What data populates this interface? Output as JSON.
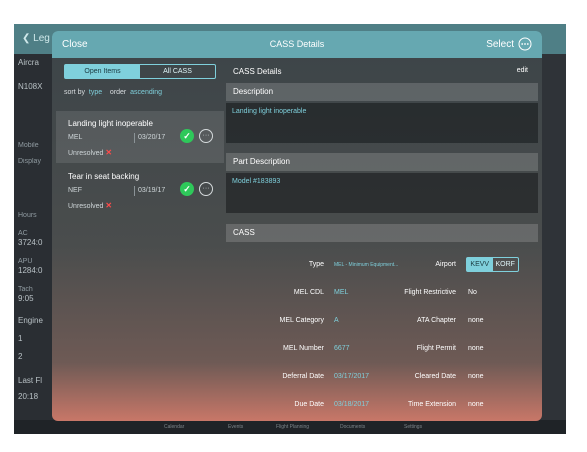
{
  "background": {
    "back_label": "Leg",
    "sidebar": [
      {
        "text": "Aircra",
        "kind": "val"
      },
      {
        "text": "N108X",
        "kind": "val"
      },
      {
        "text": "Mobile",
        "kind": "lbl"
      },
      {
        "text": "Display",
        "kind": "lbl"
      },
      {
        "text": "Hours",
        "kind": "lbl"
      },
      {
        "text": "AC",
        "kind": "lbl"
      },
      {
        "text": "3724:0",
        "kind": "val"
      },
      {
        "text": "APU",
        "kind": "lbl"
      },
      {
        "text": "1284:0",
        "kind": "val"
      },
      {
        "text": "Tach",
        "kind": "lbl"
      },
      {
        "text": "9:05",
        "kind": "val"
      },
      {
        "text": "Engine",
        "kind": "val"
      },
      {
        "text": "1",
        "kind": "val"
      },
      {
        "text": "2",
        "kind": "val"
      },
      {
        "text": "Last Fl",
        "kind": "val"
      },
      {
        "text": "20:18",
        "kind": "val"
      }
    ],
    "tabbar": [
      "Calendar",
      "Events",
      "Flight Planning",
      "Documents",
      "Settings"
    ]
  },
  "modal": {
    "close_label": "Close",
    "title": "CASS Details",
    "select_label": "Select"
  },
  "left": {
    "segments": [
      {
        "label": "Open Items",
        "active": true
      },
      {
        "label": "All CASS",
        "active": false
      }
    ],
    "sort_label": "sort by",
    "sort_value": "type",
    "order_label": "order",
    "order_value": "ascending",
    "items": [
      {
        "title": "Landing light inoperable",
        "type": "MEL",
        "date": "03/20/17",
        "status": "Unresolved"
      },
      {
        "title": "Tear in seat backing",
        "type": "NEF",
        "date": "03/19/17",
        "status": "Unresolved"
      }
    ]
  },
  "right": {
    "details_title": "CASS Details",
    "edit_label": "edit",
    "description_label": "Description",
    "description_value": "Landing light inoperable",
    "part_description_label": "Part Description",
    "part_description_value": "Model #183893",
    "cass_label": "CASS",
    "fields_left": [
      {
        "label": "Type",
        "value": "MEL - Minimum Equipment..."
      },
      {
        "label": "MEL CDL",
        "value": "MEL"
      },
      {
        "label": "MEL Category",
        "value": "A"
      },
      {
        "label": "MEL Number",
        "value": "6677"
      },
      {
        "label": "Deferral Date",
        "value": "03/17/2017"
      },
      {
        "label": "Due Date",
        "value": "03/18/2017"
      }
    ],
    "airport_label": "Airport",
    "airport_options": [
      {
        "label": "KEVV",
        "active": true
      },
      {
        "label": "KORF",
        "active": false
      }
    ],
    "fields_right": [
      {
        "label": "Flight Restrictive",
        "value": "No"
      },
      {
        "label": "ATA Chapter",
        "value": "none"
      },
      {
        "label": "Flight Permit",
        "value": "none"
      },
      {
        "label": "Cleared Date",
        "value": "none"
      },
      {
        "label": "Time Extension",
        "value": "none"
      }
    ]
  }
}
